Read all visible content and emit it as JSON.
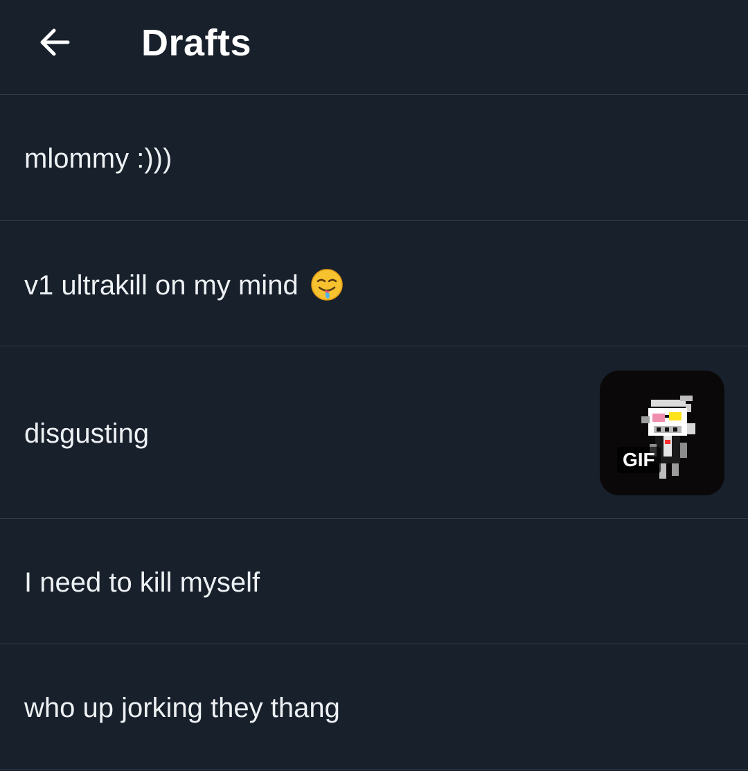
{
  "header": {
    "title": "Drafts",
    "back_icon": "arrow-left-icon"
  },
  "drafts": [
    {
      "text": "mlommy :)))"
    },
    {
      "text": "v1 ultrakill on my mind",
      "emoji": "drooling-face"
    },
    {
      "text": "disgusting",
      "attachment": {
        "type": "gif",
        "badge": "GIF"
      }
    },
    {
      "text": "I need to kill myself"
    },
    {
      "text": "who up jorking they thang"
    }
  ],
  "colors": {
    "background": "#17202b",
    "divider": "#2f3a46",
    "text": "#eef1f4"
  }
}
